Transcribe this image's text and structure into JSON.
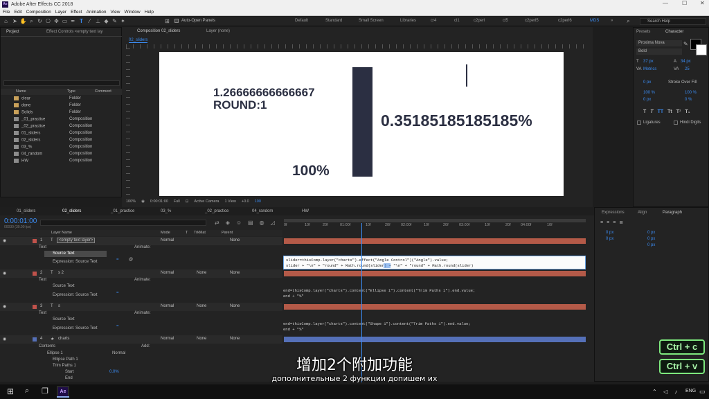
{
  "window": {
    "title": "Adobe After Effects CC 2018",
    "logo": "Ae"
  },
  "menu": [
    "File",
    "Edit",
    "Composition",
    "Layer",
    "Effect",
    "Animation",
    "View",
    "Window",
    "Help"
  ],
  "toolbar": {
    "auto_open": "Auto-Open Panels",
    "workspaces": [
      "Default",
      "Standard",
      "Small Screen",
      "Libraries",
      "cr4",
      "cl1",
      "c2perl",
      "cl5",
      "c2perl5",
      "c2perl6",
      "MDS"
    ],
    "search": "Search Help"
  },
  "project": {
    "tab1": "Project",
    "tab2": "Effect Controls <empty text lay",
    "columns": [
      "Name",
      "Type",
      "Comment"
    ],
    "items": [
      {
        "name": "clear",
        "type": "Folder"
      },
      {
        "name": "done",
        "type": "Folder"
      },
      {
        "name": "Solids",
        "type": "Folder"
      },
      {
        "name": "_01_practice",
        "type": "Composition"
      },
      {
        "name": "_02_practice",
        "type": "Composition"
      },
      {
        "name": "01_sliders",
        "type": "Composition"
      },
      {
        "name": "02_sliders",
        "type": "Composition"
      },
      {
        "name": "03_%",
        "type": "Composition"
      },
      {
        "name": "04_random",
        "type": "Composition"
      },
      {
        "name": "HW",
        "type": "Composition"
      }
    ]
  },
  "viewer": {
    "tab": "Composition 02_sliders",
    "layer_tab": "Layer (none)",
    "subtab": "02_sliders",
    "text1": "1.26666666666667",
    "text2": "ROUND:1",
    "text3": "100%",
    "text4": "0.35185185185185%",
    "zoom": "100%",
    "time": "0:00:01:00",
    "quality": "Full",
    "camera": "Active Camera",
    "views": "1 View",
    "offset": "+0.0",
    "exposure": "100"
  },
  "character": {
    "tab1": "Presets",
    "tab2": "Character",
    "font": "Proxima Nova",
    "style": "Bold",
    "size": "37 px",
    "leading": "34 px",
    "kerning": "Metrics",
    "tracking": "25",
    "stroke": "0 px",
    "stroke_mode": "Stroke Over Fill",
    "vscale": "100 %",
    "hscale": "100 %",
    "baseline": "0 px",
    "tsume": "0 %",
    "ligatures": "Ligatures",
    "hindi": "Hindi Digits"
  },
  "timeline": {
    "tabs": [
      "01_sliders",
      "02_sliders",
      "_01_practice",
      "03_%",
      "_02_practice",
      "04_random",
      "HW"
    ],
    "time": "0:00:01:00",
    "frames": "00030 (30.00 fps)",
    "headers": [
      "Layer Name",
      "Mode",
      "T",
      "TrkMat",
      "Parent"
    ],
    "ticks": [
      "0f",
      "10f",
      "20f",
      "01:00f",
      "10f",
      "20f",
      "02:00f",
      "10f",
      "20f",
      "03:00f",
      "10f",
      "20f",
      "04:00f",
      "10f"
    ],
    "layers": [
      {
        "num": "1",
        "name": "<empty text layer>",
        "mode": "Normal",
        "parent": "None",
        "animate": "Animate:"
      },
      {
        "num": "2",
        "name": "s 2",
        "mode": "Normal",
        "trk": "None",
        "parent": "None",
        "animate": "Animate:"
      },
      {
        "num": "3",
        "name": "s",
        "mode": "Normal",
        "trk": "None",
        "parent": "None",
        "animate": "Animate:"
      },
      {
        "num": "4",
        "name": "charts",
        "mode": "Normal",
        "trk": "None",
        "parent": "None",
        "add": "Add:"
      }
    ],
    "props": {
      "text": "Text",
      "source_text": "Source Text",
      "expr": "Expression: Source Text",
      "contents": "Contents",
      "ellipse": "Ellipse 1",
      "ellipse_path": "Ellipse Path 1",
      "trim": "Trim Paths 1",
      "start": "Start",
      "start_val": "0.0%",
      "end": "End",
      "ellipse_mode": "Normal"
    },
    "expr1_line1": "slider=thisComp.layer(\"charts\").effect(\"Angle Control\")(\"Angle\").value;",
    "expr1_line2": "slider + \"\\n\" + \"round\" + Math.round(slider) + \"\\n\" + \"round\" + Math.round(slider)",
    "expr1_hl": "round",
    "expr2_line1": "end=thisComp.layer(\"charts\").content(\"Ellipse 1\").content(\"Trim Paths 1\").end.value;",
    "expr2_line2": "end + \"%\"",
    "expr3_line1": "end=thisComp.layer(\"charts\").content(\"Shape 1\").content(\"Trim Paths 1\").end.value;",
    "expr3_line2": "end + \"%\""
  },
  "rightbottom": {
    "tabs": [
      "Expressions",
      "Align",
      "Paragraph"
    ],
    "p1": "0 px",
    "p2": "0 px",
    "p3": "0 px",
    "p4": "0 px",
    "p5": "0 px"
  },
  "overlay": {
    "kbd1": "Ctrl + c",
    "kbd2": "Ctrl + v",
    "subtitle_cn": "增加2个附加功能",
    "subtitle_ru": "дополнительные 2 функции допишем их"
  },
  "taskbar": {
    "lang": "ENG",
    "app": "Ae"
  },
  "colors": {
    "red_bar": "#b45a48",
    "blue_bar": "#5570b8",
    "accent": "#3b8cf3",
    "chart_bar": "#2b2f42"
  }
}
